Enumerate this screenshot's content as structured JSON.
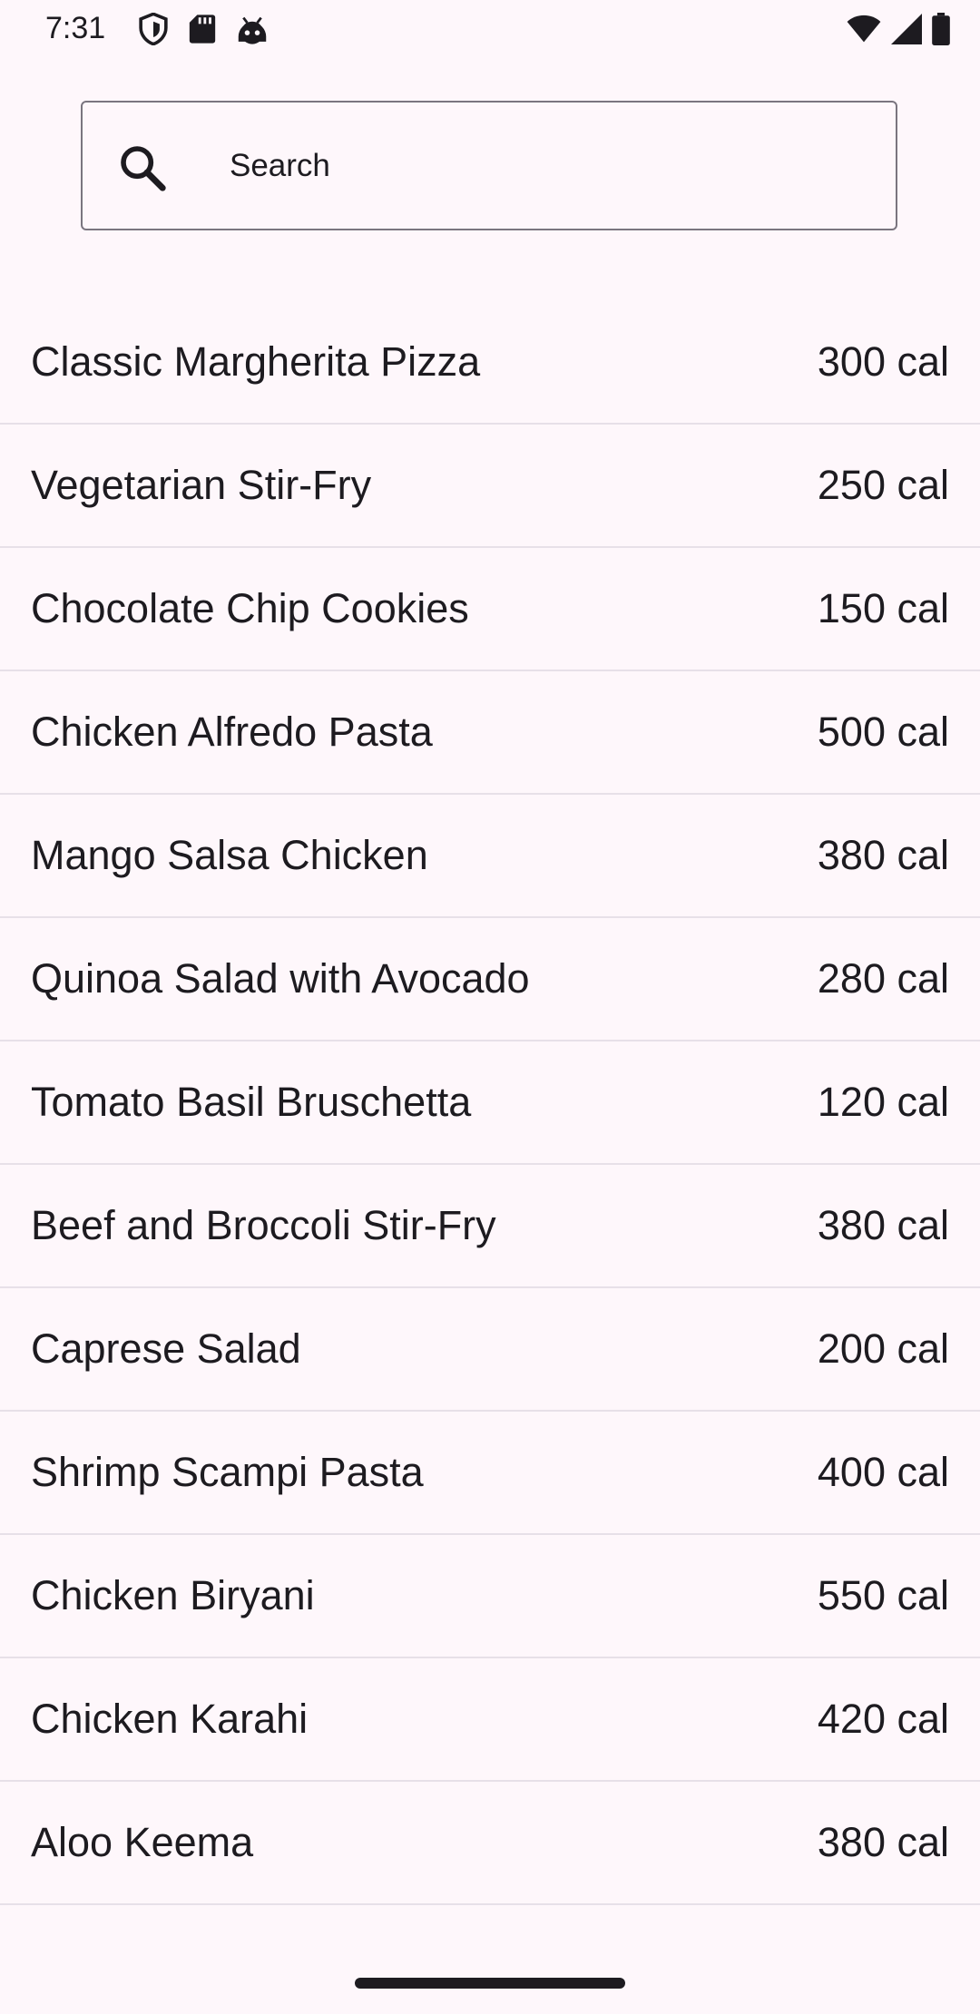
{
  "status_bar": {
    "time": "7:31",
    "left_icons": [
      "shield-icon",
      "sd-card-icon",
      "android-robot-icon"
    ],
    "right_icons": [
      "wifi-icon",
      "cellular-signal-icon",
      "battery-icon"
    ]
  },
  "search": {
    "placeholder": "Search",
    "value": ""
  },
  "recipes": [
    {
      "name": "Classic Margherita Pizza",
      "calories": "300 cal"
    },
    {
      "name": "Vegetarian Stir-Fry",
      "calories": "250 cal"
    },
    {
      "name": "Chocolate Chip Cookies",
      "calories": "150 cal"
    },
    {
      "name": "Chicken Alfredo Pasta",
      "calories": "500 cal"
    },
    {
      "name": "Mango Salsa Chicken",
      "calories": "380 cal"
    },
    {
      "name": "Quinoa Salad with Avocado",
      "calories": "280 cal"
    },
    {
      "name": "Tomato Basil Bruschetta",
      "calories": "120 cal"
    },
    {
      "name": "Beef and Broccoli Stir-Fry",
      "calories": "380 cal"
    },
    {
      "name": "Caprese Salad",
      "calories": "200 cal"
    },
    {
      "name": "Shrimp Scampi Pasta",
      "calories": "400 cal"
    },
    {
      "name": "Chicken Biryani",
      "calories": "550 cal"
    },
    {
      "name": "Chicken Karahi",
      "calories": "420 cal"
    },
    {
      "name": "Aloo Keema",
      "calories": "380 cal"
    }
  ],
  "colors": {
    "background": "#FEF7FB",
    "text": "#1D1B20",
    "outline": "#7A757F",
    "divider": "#E7E0E8"
  }
}
